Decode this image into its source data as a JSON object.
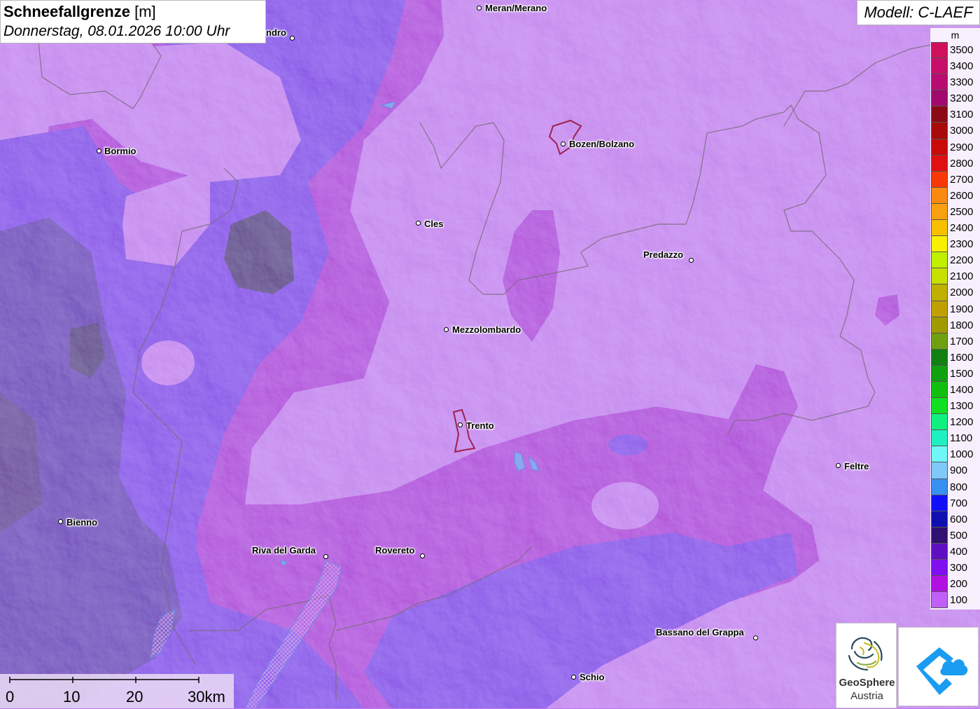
{
  "title": {
    "main_bold": "Schneefallgrenze",
    "main_unit": "[m]",
    "subtitle": "Donnerstag, 08.01.2026 10:00 Uhr"
  },
  "model": "Modell: C-LAEF",
  "legend": {
    "unit": "m",
    "entries": [
      {
        "label": "3500",
        "color": "#d0105a"
      },
      {
        "label": "3400",
        "color": "#c80e6a"
      },
      {
        "label": "3300",
        "color": "#b80c72"
      },
      {
        "label": "3200",
        "color": "#a00a6e"
      },
      {
        "label": "3100",
        "color": "#8c0a14"
      },
      {
        "label": "3000",
        "color": "#a80a0a"
      },
      {
        "label": "2900",
        "color": "#c80a0a"
      },
      {
        "label": "2800",
        "color": "#e01010"
      },
      {
        "label": "2700",
        "color": "#f83808"
      },
      {
        "label": "2600",
        "color": "#f88a10"
      },
      {
        "label": "2500",
        "color": "#f8a010"
      },
      {
        "label": "2400",
        "color": "#f8c000"
      },
      {
        "label": "2300",
        "color": "#f8f000"
      },
      {
        "label": "2200",
        "color": "#c0f000"
      },
      {
        "label": "2100",
        "color": "#c8e000"
      },
      {
        "label": "2000",
        "color": "#c0b000"
      },
      {
        "label": "1900",
        "color": "#c0a000"
      },
      {
        "label": "1800",
        "color": "#a09a00"
      },
      {
        "label": "1700",
        "color": "#70a010"
      },
      {
        "label": "1600",
        "color": "#108010"
      },
      {
        "label": "1500",
        "color": "#10a010"
      },
      {
        "label": "1400",
        "color": "#10c010"
      },
      {
        "label": "1300",
        "color": "#10e020"
      },
      {
        "label": "1200",
        "color": "#10f080"
      },
      {
        "label": "1100",
        "color": "#20f0c0"
      },
      {
        "label": "1000",
        "color": "#70f8f8"
      },
      {
        "label": "900",
        "color": "#80c8f8"
      },
      {
        "label": "800",
        "color": "#3890f0"
      },
      {
        "label": "700",
        "color": "#1010f8"
      },
      {
        "label": "600",
        "color": "#1010b0"
      },
      {
        "label": "500",
        "color": "#301070"
      },
      {
        "label": "400",
        "color": "#6010c0"
      },
      {
        "label": "300",
        "color": "#8010f0"
      },
      {
        "label": "200",
        "color": "#b010e0"
      },
      {
        "label": "100",
        "color": "#c060f8"
      }
    ]
  },
  "cities": [
    {
      "id": "meran",
      "name": "Meran/Merano"
    },
    {
      "id": "sondrio",
      "name": "ndro"
    },
    {
      "id": "bormio",
      "name": "Bormio"
    },
    {
      "id": "bozen",
      "name": "Bozen/Bolzano"
    },
    {
      "id": "cles",
      "name": "Cles"
    },
    {
      "id": "predazzo",
      "name": "Predazzo"
    },
    {
      "id": "mezzolombardo",
      "name": "Mezzolombardo"
    },
    {
      "id": "trento",
      "name": "Trento"
    },
    {
      "id": "feltre",
      "name": "Feltre"
    },
    {
      "id": "bienno",
      "name": "Bienno"
    },
    {
      "id": "riva",
      "name": "Riva del Garda"
    },
    {
      "id": "rovereto",
      "name": "Rovereto"
    },
    {
      "id": "bassano",
      "name": "Bassano del Grappa"
    },
    {
      "id": "schio",
      "name": "Schio"
    }
  ],
  "scalebar": {
    "labels": [
      "0",
      "10",
      "20",
      "30km"
    ]
  },
  "logos": {
    "geosphere_line1": "GeoSphere",
    "geosphere_line2": "Austria"
  },
  "colors": {
    "base_light": "#c880f8",
    "mid_magenta": "#b020e0",
    "violet": "#8030f0",
    "dark_violet": "#5a1aa8",
    "border_line": "#7a6a7a",
    "city_outline": "#a02050",
    "lake": "#8aa8f0"
  }
}
